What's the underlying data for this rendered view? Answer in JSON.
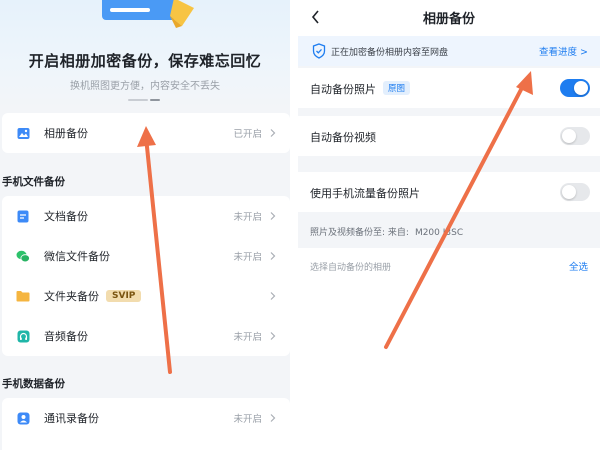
{
  "left": {
    "hero": {
      "title": "开启相册加密备份，保存难忘回忆",
      "subtitle": "换机照图更方便，内容安全不丢失"
    },
    "album_item": {
      "label": "相册备份",
      "status": "已开启"
    },
    "file_section": {
      "header": "手机文件备份",
      "items": [
        {
          "label": "文档备份",
          "status": "未开启",
          "icon": "document-icon",
          "color": "#3d8af7"
        },
        {
          "label": "微信文件备份",
          "status": "未开启",
          "icon": "wechat-icon",
          "color": "#2dc26b"
        },
        {
          "label": "文件夹备份",
          "badge": "SVIP",
          "icon": "folder-icon",
          "color": "#f5b540"
        },
        {
          "label": "音频备份",
          "status": "未开启",
          "icon": "audio-icon",
          "color": "#20b6a8"
        }
      ]
    },
    "data_section": {
      "header": "手机数据备份",
      "items": [
        {
          "label": "通讯录备份",
          "status": "未开启",
          "icon": "contacts-icon",
          "color": "#3d8af7"
        }
      ]
    }
  },
  "right": {
    "title": "相册备份",
    "banner": {
      "text": "正在加密备份相册内容至网盘",
      "link": "查看进度 >"
    },
    "settings": [
      {
        "label": "自动备份照片",
        "tag": "原图",
        "enabled": true
      },
      {
        "label": "自动备份视频",
        "enabled": false
      },
      {
        "label": "使用手机流量备份照片",
        "enabled": false
      }
    ],
    "source": {
      "label": "照片及视频备份至:  来自:",
      "device": "M200 J3SC"
    },
    "album_select": {
      "label": "选择自动备份的相册",
      "select_all": "全选"
    }
  },
  "colors": {
    "accent": "#1e7df0",
    "annotation_arrow": "#ee7048",
    "toggle_off": "#e6e8eb",
    "svip_bg": "#f2dcae"
  }
}
